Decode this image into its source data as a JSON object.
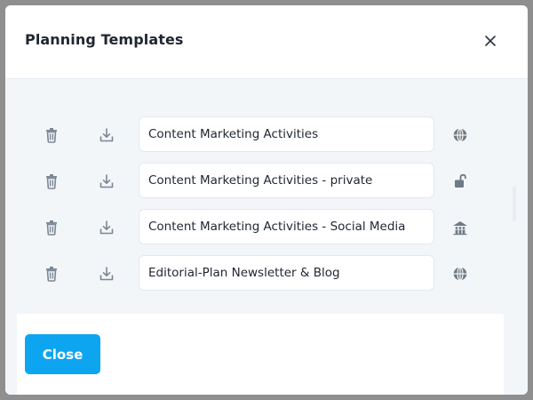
{
  "modal": {
    "title": "Planning Templates",
    "close_icon": "close-icon",
    "footer_close_label": "Close",
    "accent_color": "#0ea5f0"
  },
  "templates": [
    {
      "name": "Content Marketing Activities",
      "visibility_icon": "globe-icon"
    },
    {
      "name": "Content Marketing Activities - private",
      "visibility_icon": "unlock-icon"
    },
    {
      "name": "Content Marketing Activities - Social Media",
      "visibility_icon": "team-icon"
    },
    {
      "name": "Editorial-Plan Newsletter & Blog",
      "visibility_icon": "globe-icon"
    }
  ],
  "row_icons": {
    "delete": "trash-icon",
    "download": "download-icon"
  }
}
